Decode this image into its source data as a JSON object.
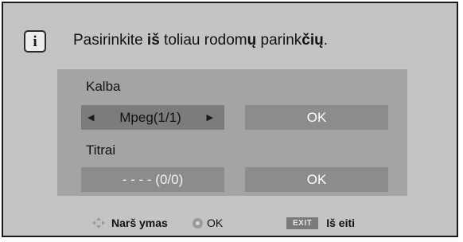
{
  "dialog": {
    "message_prefix": "Pasirinkite ",
    "message_b1": "iš",
    "message_mid": "  toliau rodom",
    "message_b2": "ų",
    "message_mid2": " parink",
    "message_b3": "čių",
    "message_suffix": "."
  },
  "icons": {
    "info": "info-icon",
    "info_glyph": "i",
    "navigate": "four-way-arrow-icon",
    "ok": "ok-button-icon",
    "left": "◀",
    "right": "▶"
  },
  "audio": {
    "label": "Kalba",
    "value": "Mpeg(1/1)",
    "ok_label": "OK"
  },
  "subtitles": {
    "label": "Titrai",
    "value": "- - - - (0/0)",
    "ok_label": "OK"
  },
  "footer": {
    "navigate_label": "Narš ymas",
    "ok_label": "OK",
    "exit_key": "EXIT",
    "exit_label": "Iš eiti"
  }
}
